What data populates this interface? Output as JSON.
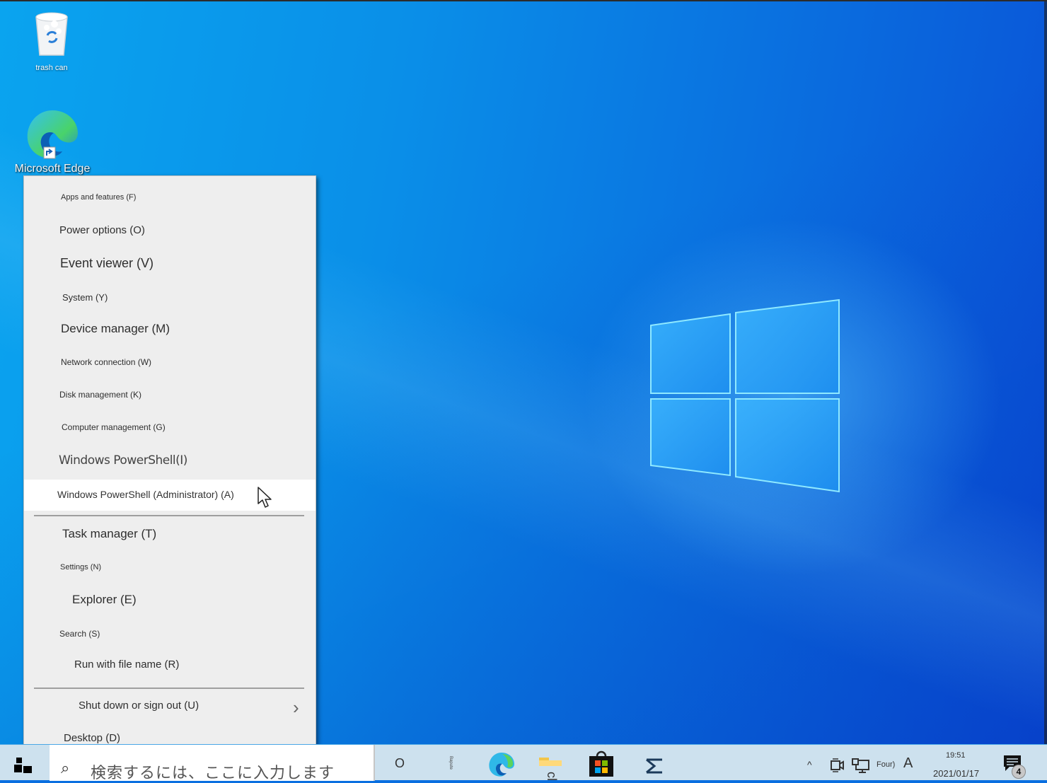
{
  "desktop": {
    "icons": [
      {
        "name": "trash-can",
        "label": "trash can"
      },
      {
        "name": "microsoft-edge",
        "label": "Microsoft Edge"
      }
    ]
  },
  "context_menu": {
    "items": [
      {
        "label": "Apps and features (F)",
        "key": "F"
      },
      {
        "label": "Power options (O)",
        "key": "O"
      },
      {
        "label": "Event viewer (V)",
        "key": "V"
      },
      {
        "label": "System (Y)",
        "key": "Y"
      },
      {
        "label": "Device manager (M)",
        "key": "M"
      },
      {
        "label": "Network connection (W)",
        "key": "W"
      },
      {
        "label": "Disk management (K)",
        "key": "K"
      },
      {
        "label": "Computer management (G)",
        "key": "G"
      },
      {
        "label": "Windows PowerShell(I)",
        "key": "I"
      },
      {
        "label": "Windows PowerShell (Administrator) (A)",
        "key": "A",
        "highlighted": true
      },
      {
        "label": "Task manager (T)",
        "key": "T"
      },
      {
        "label": "Settings (N)",
        "key": "N"
      },
      {
        "label": "Explorer (E)",
        "key": "E"
      },
      {
        "label": "Search (S)",
        "key": "S"
      },
      {
        "label": "Run with file name (R)",
        "key": "R"
      },
      {
        "label": "Shut down or sign out (U)",
        "key": "U",
        "submenu": true
      },
      {
        "label": "Desktop (D)",
        "key": "D"
      }
    ]
  },
  "taskbar": {
    "search_placeholder": "検索するには、ここに入力します",
    "cortana_label": "O",
    "taskview_label": "Bapute",
    "pinned": [
      "microsoft-edge",
      "file-explorer",
      "microsoft-store",
      "mail"
    ],
    "tray": {
      "ime_label": "Four)",
      "ime_mode": "A",
      "chevron": "^",
      "time": "19:51",
      "date": "2021/01/17",
      "notification_count": "4"
    }
  },
  "colors": {
    "menu_bg": "#eeeeee",
    "menu_highlight": "#ffffff",
    "taskbar_bg": "#cde1ee",
    "wallpaper_blue": "#0a8fe8"
  }
}
